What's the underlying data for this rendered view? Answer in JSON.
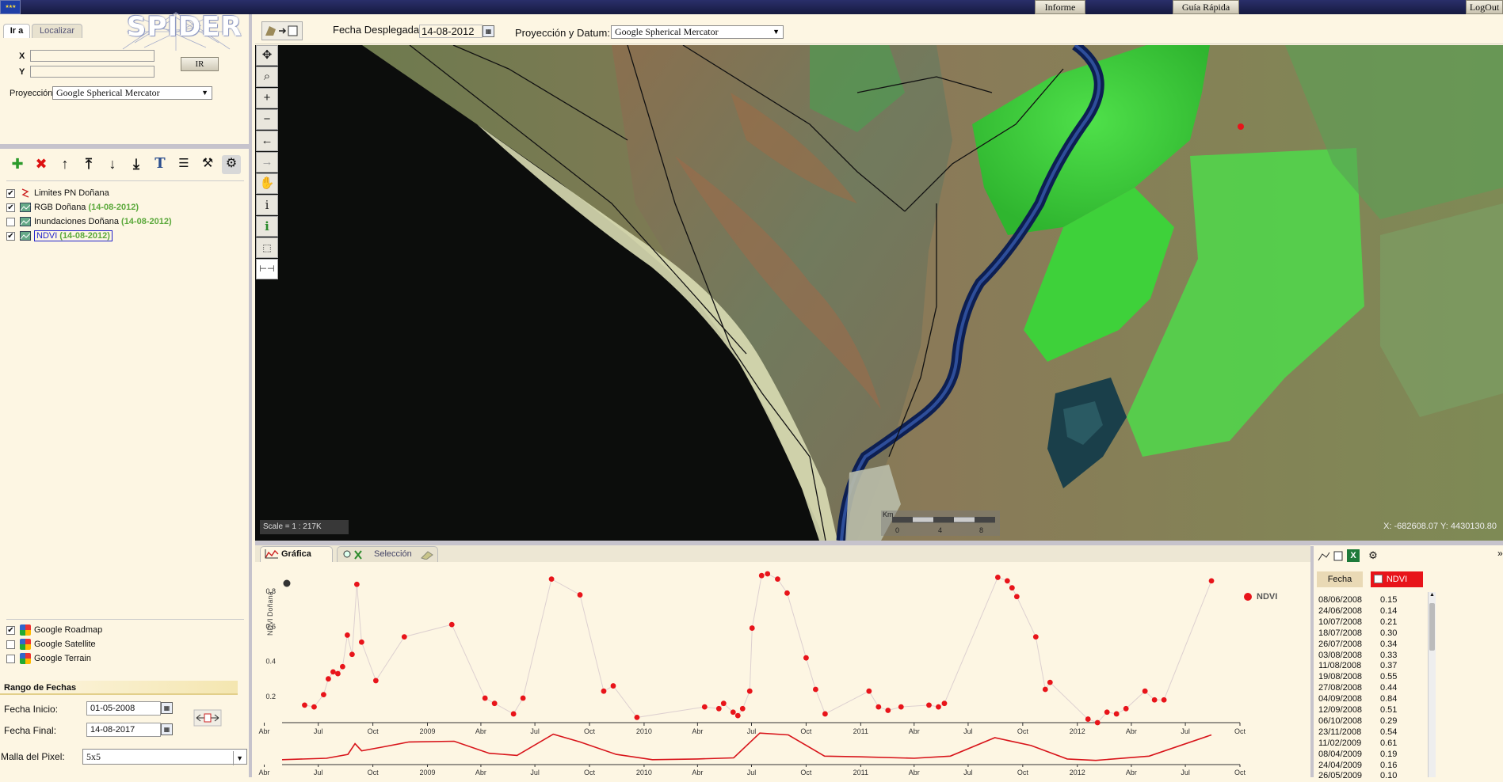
{
  "topbar": {
    "informe_label": "Informe",
    "guia_label": "Guía Rápida",
    "logout_label": "LogOut"
  },
  "logo": {
    "text": "SPIDER"
  },
  "goto": {
    "tab_ira": "Ir a",
    "tab_localizar": "Localizar",
    "x_label": "X",
    "y_label": "Y",
    "x_value": "",
    "y_value": "",
    "ir_button": "IR",
    "projection_label": "Proyección",
    "projection_value": "Google Spherical Mercator"
  },
  "layers": [
    {
      "name": "Limites PN Doñana",
      "date": "",
      "checked": true
    },
    {
      "name": "RGB Doñana",
      "date": "(14-08-2012)",
      "checked": true
    },
    {
      "name": "Inundaciones Doñana",
      "date": "(14-08-2012)",
      "checked": false
    },
    {
      "name": "NDVI",
      "date": "(14-08-2012)",
      "checked": true
    }
  ],
  "basemaps": [
    {
      "name": "Google Roadmap",
      "checked": true
    },
    {
      "name": "Google Satellite",
      "checked": false
    },
    {
      "name": "Google Terrain",
      "checked": false
    }
  ],
  "dates": {
    "section_title": "Rango de Fechas",
    "start_label": "Fecha Inicio:",
    "start_value": "01-05-2008",
    "end_label": "Fecha Final:",
    "end_value": "14-08-2017",
    "pixel_label": "Malla del Pixel:",
    "pixel_value": "5x5"
  },
  "maptop": {
    "fecha_label": "Fecha Desplegada:",
    "fecha_value": "14-08-2012",
    "proj_label": "Proyección y Datum:",
    "proj_value": "Google Spherical Mercator"
  },
  "map": {
    "scale_text": "Scale = 1 : 217K",
    "coords_text": "X: -682608.07 Y: 4430130.80",
    "scalebar_unit": "Km",
    "scalebar_ticks": [
      "0",
      "4",
      "8"
    ]
  },
  "bottom_tabs": {
    "grafica": "Gráfica",
    "seleccion": "Selección"
  },
  "chart_data": {
    "type": "scatter",
    "ylabel": "NDVI Doñana",
    "legend": "NDVI",
    "legend_position": "top-right",
    "yticks": [
      "0.2",
      "0.4",
      "0.6",
      "0.8"
    ],
    "ylim": [
      0.05,
      0.9
    ],
    "xlim": [
      "2008-05-01",
      "2012-10-01"
    ],
    "xticks": [
      "Abr",
      "Jul",
      "Oct",
      "2009",
      "Abr",
      "Jul",
      "Oct",
      "2010",
      "Abr",
      "Jul",
      "Oct",
      "2011",
      "Abr",
      "Jul",
      "Oct",
      "2012",
      "Abr",
      "Jul",
      "Oct"
    ],
    "series": [
      {
        "name": "NDVI",
        "color": "#e8141a",
        "points": [
          [
            "2008-06-08",
            0.15
          ],
          [
            "2008-06-24",
            0.14
          ],
          [
            "2008-07-10",
            0.21
          ],
          [
            "2008-07-18",
            0.3
          ],
          [
            "2008-07-26",
            0.34
          ],
          [
            "2008-08-03",
            0.33
          ],
          [
            "2008-08-11",
            0.37
          ],
          [
            "2008-08-19",
            0.55
          ],
          [
            "2008-08-27",
            0.44
          ],
          [
            "2008-09-04",
            0.84
          ],
          [
            "2008-09-12",
            0.51
          ],
          [
            "2008-10-06",
            0.29
          ],
          [
            "2008-11-23",
            0.54
          ],
          [
            "2009-02-11",
            0.61
          ],
          [
            "2009-04-08",
            0.19
          ],
          [
            "2009-04-24",
            0.16
          ],
          [
            "2009-05-26",
            0.1
          ],
          [
            "2009-06-11",
            0.19
          ],
          [
            "2009-07-29",
            0.87
          ],
          [
            "2009-09-15",
            0.78
          ],
          [
            "2009-10-25",
            0.23
          ],
          [
            "2009-11-10",
            0.26
          ],
          [
            "2009-12-20",
            0.08
          ],
          [
            "2010-04-13",
            0.14
          ],
          [
            "2010-05-07",
            0.13
          ],
          [
            "2010-05-15",
            0.16
          ],
          [
            "2010-05-31",
            0.11
          ],
          [
            "2010-06-08",
            0.09
          ],
          [
            "2010-06-16",
            0.13
          ],
          [
            "2010-06-28",
            0.23
          ],
          [
            "2010-07-02",
            0.59
          ],
          [
            "2010-07-18",
            0.89
          ],
          [
            "2010-07-28",
            0.9
          ],
          [
            "2010-08-14",
            0.87
          ],
          [
            "2010-08-30",
            0.79
          ],
          [
            "2010-10-01",
            0.42
          ],
          [
            "2010-10-17",
            0.24
          ],
          [
            "2010-11-02",
            0.1
          ],
          [
            "2011-01-15",
            0.23
          ],
          [
            "2011-01-31",
            0.14
          ],
          [
            "2011-02-16",
            0.12
          ],
          [
            "2011-03-10",
            0.14
          ],
          [
            "2011-04-26",
            0.15
          ],
          [
            "2011-05-12",
            0.14
          ],
          [
            "2011-05-22",
            0.16
          ],
          [
            "2011-08-20",
            0.88
          ],
          [
            "2011-09-05",
            0.86
          ],
          [
            "2011-09-13",
            0.82
          ],
          [
            "2011-09-21",
            0.77
          ],
          [
            "2011-10-23",
            0.54
          ],
          [
            "2011-11-08",
            0.24
          ],
          [
            "2011-11-16",
            0.28
          ],
          [
            "2012-01-19",
            0.07
          ],
          [
            "2012-02-04",
            0.05
          ],
          [
            "2012-02-20",
            0.11
          ],
          [
            "2012-03-07",
            0.1
          ],
          [
            "2012-03-23",
            0.13
          ],
          [
            "2012-04-24",
            0.23
          ],
          [
            "2012-05-10",
            0.18
          ],
          [
            "2012-05-26",
            0.18
          ],
          [
            "2012-08-14",
            0.86
          ]
        ]
      }
    ],
    "overview_line": [
      [
        "2008-05-01",
        0.1
      ],
      [
        "2008-07-15",
        0.14
      ],
      [
        "2008-08-20",
        0.25
      ],
      [
        "2008-09-01",
        0.55
      ],
      [
        "2008-09-12",
        0.35
      ],
      [
        "2008-10-15",
        0.45
      ],
      [
        "2008-12-01",
        0.6
      ],
      [
        "2009-02-15",
        0.62
      ],
      [
        "2009-04-15",
        0.28
      ],
      [
        "2009-06-01",
        0.22
      ],
      [
        "2009-08-01",
        0.82
      ],
      [
        "2009-09-15",
        0.6
      ],
      [
        "2009-11-15",
        0.25
      ],
      [
        "2010-01-15",
        0.1
      ],
      [
        "2010-04-01",
        0.12
      ],
      [
        "2010-06-01",
        0.15
      ],
      [
        "2010-07-15",
        0.85
      ],
      [
        "2010-09-01",
        0.8
      ],
      [
        "2010-11-01",
        0.2
      ],
      [
        "2011-01-01",
        0.18
      ],
      [
        "2011-04-01",
        0.14
      ],
      [
        "2011-06-01",
        0.2
      ],
      [
        "2011-08-15",
        0.72
      ],
      [
        "2011-10-15",
        0.5
      ],
      [
        "2011-12-15",
        0.12
      ],
      [
        "2012-02-01",
        0.08
      ],
      [
        "2012-05-01",
        0.2
      ],
      [
        "2012-08-14",
        0.8
      ]
    ]
  },
  "table": {
    "col_fecha": "Fecha",
    "col_ndvi": "NDVI",
    "rows": [
      [
        "08/06/2008",
        "0.15"
      ],
      [
        "24/06/2008",
        "0.14"
      ],
      [
        "10/07/2008",
        "0.21"
      ],
      [
        "18/07/2008",
        "0.30"
      ],
      [
        "26/07/2008",
        "0.34"
      ],
      [
        "03/08/2008",
        "0.33"
      ],
      [
        "11/08/2008",
        "0.37"
      ],
      [
        "19/08/2008",
        "0.55"
      ],
      [
        "27/08/2008",
        "0.44"
      ],
      [
        "04/09/2008",
        "0.84"
      ],
      [
        "12/09/2008",
        "0.51"
      ],
      [
        "06/10/2008",
        "0.29"
      ],
      [
        "23/11/2008",
        "0.54"
      ],
      [
        "11/02/2009",
        "0.61"
      ],
      [
        "08/04/2009",
        "0.19"
      ],
      [
        "24/04/2009",
        "0.16"
      ],
      [
        "26/05/2009",
        "0.10"
      ]
    ]
  }
}
